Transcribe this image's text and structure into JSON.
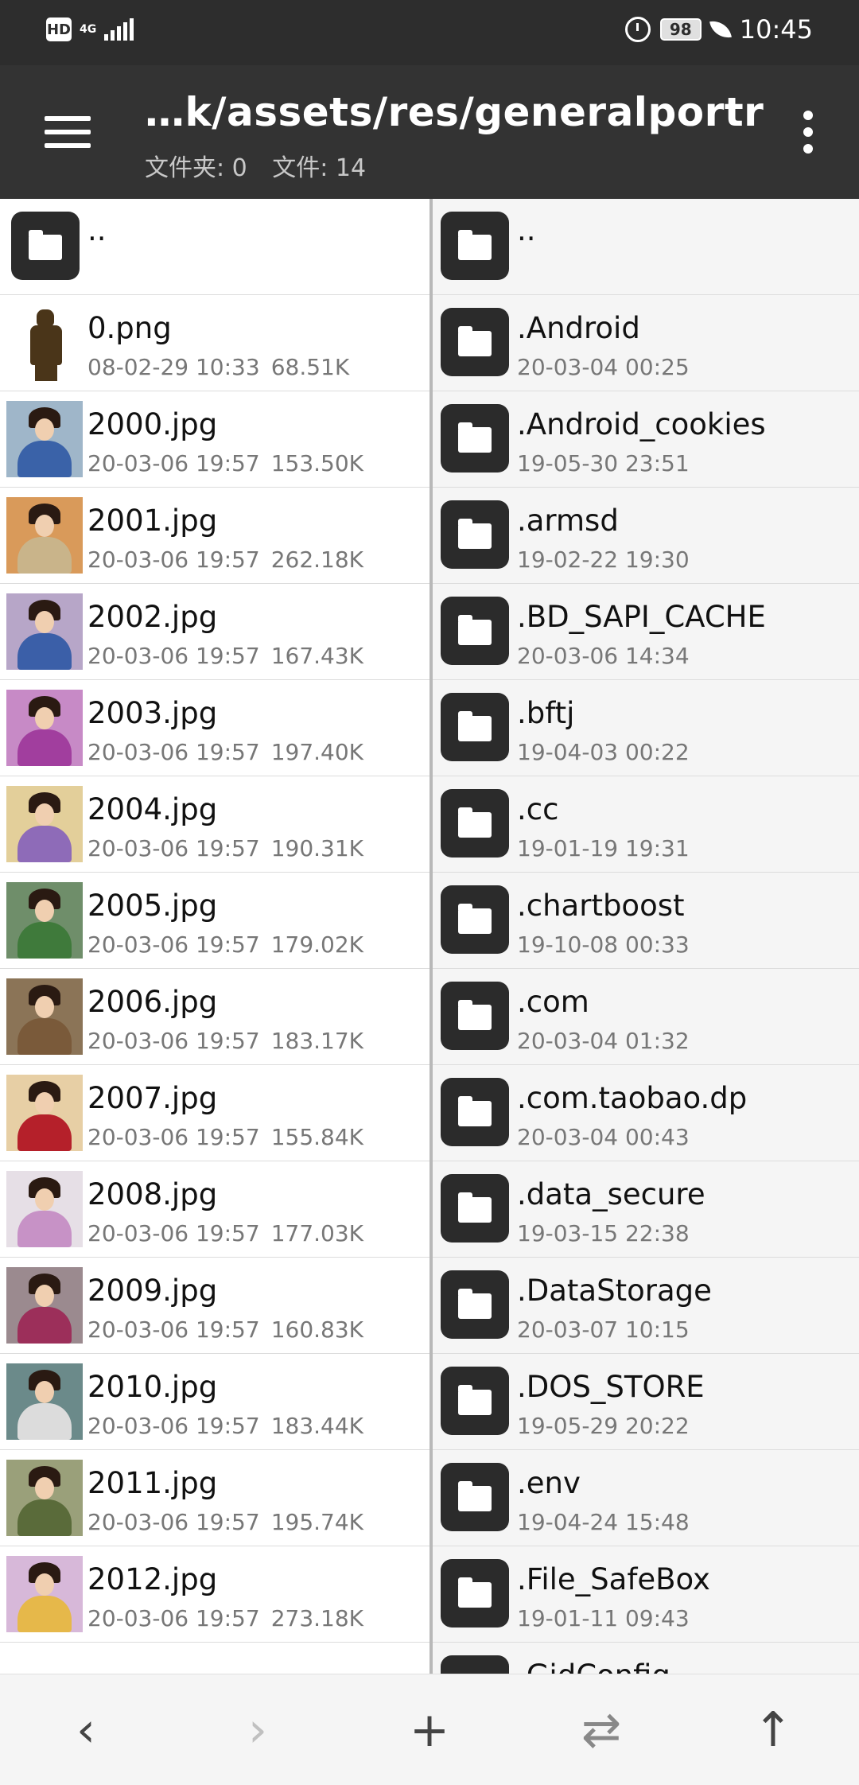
{
  "status_bar": {
    "hd_label": "HD",
    "network_label": "4G",
    "battery": "98",
    "time": "10:45"
  },
  "toolbar": {
    "path": "…k/assets/res/generalportrait/",
    "folder_count_label": "文件夹: 0",
    "file_count_label": "文件: 14"
  },
  "left_pane": {
    "parent_label": "..",
    "files": [
      {
        "name": "0.png",
        "date": "08-02-29 10:33",
        "size": "68.51K",
        "thumb": "silhouette"
      },
      {
        "name": "2000.jpg",
        "date": "20-03-06 19:57",
        "size": "153.50K",
        "robe": "#3a62a8",
        "bg": "#9fb6c9"
      },
      {
        "name": "2001.jpg",
        "date": "20-03-06 19:57",
        "size": "262.18K",
        "robe": "#c9b48a",
        "bg": "#d99a5a"
      },
      {
        "name": "2002.jpg",
        "date": "20-03-06 19:57",
        "size": "167.43K",
        "robe": "#3b5fa8",
        "bg": "#b7a6c8"
      },
      {
        "name": "2003.jpg",
        "date": "20-03-06 19:57",
        "size": "197.40K",
        "robe": "#a13e9e",
        "bg": "#c78ac6"
      },
      {
        "name": "2004.jpg",
        "date": "20-03-06 19:57",
        "size": "190.31K",
        "robe": "#8e6bb8",
        "bg": "#e3cf9a"
      },
      {
        "name": "2005.jpg",
        "date": "20-03-06 19:57",
        "size": "179.02K",
        "robe": "#3f7a3b",
        "bg": "#6f8e6a"
      },
      {
        "name": "2006.jpg",
        "date": "20-03-06 19:57",
        "size": "183.17K",
        "robe": "#7a5a3a",
        "bg": "#8b7457"
      },
      {
        "name": "2007.jpg",
        "date": "20-03-06 19:57",
        "size": "155.84K",
        "robe": "#b5202a",
        "bg": "#e7cfa5"
      },
      {
        "name": "2008.jpg",
        "date": "20-03-06 19:57",
        "size": "177.03K",
        "robe": "#c792c6",
        "bg": "#e6dfe6"
      },
      {
        "name": "2009.jpg",
        "date": "20-03-06 19:57",
        "size": "160.83K",
        "robe": "#9c2f5a",
        "bg": "#9b8a8f"
      },
      {
        "name": "2010.jpg",
        "date": "20-03-06 19:57",
        "size": "183.44K",
        "robe": "#dcdcdc",
        "bg": "#6b8a8a"
      },
      {
        "name": "2011.jpg",
        "date": "20-03-06 19:57",
        "size": "195.74K",
        "robe": "#5a6b3a",
        "bg": "#9aa07a"
      },
      {
        "name": "2012.jpg",
        "date": "20-03-06 19:57",
        "size": "273.18K",
        "robe": "#e6b84a",
        "bg": "#d7b8d9"
      }
    ]
  },
  "right_pane": {
    "parent_label": "..",
    "folders": [
      {
        "name": ".Android",
        "date": "20-03-04 00:25"
      },
      {
        "name": ".Android_cookies",
        "date": "19-05-30 23:51"
      },
      {
        "name": ".armsd",
        "date": "19-02-22 19:30"
      },
      {
        "name": ".BD_SAPI_CACHE",
        "date": "20-03-06 14:34"
      },
      {
        "name": ".bftj",
        "date": "19-04-03 00:22"
      },
      {
        "name": ".cc",
        "date": "19-01-19 19:31"
      },
      {
        "name": ".chartboost",
        "date": "19-10-08 00:33"
      },
      {
        "name": ".com",
        "date": "20-03-04 01:32"
      },
      {
        "name": ".com.taobao.dp",
        "date": "20-03-04 00:43"
      },
      {
        "name": ".data_secure",
        "date": "19-03-15 22:38"
      },
      {
        "name": ".DataStorage",
        "date": "20-03-07 10:15"
      },
      {
        "name": ".DOS_STORE",
        "date": "19-05-29 20:22"
      },
      {
        "name": ".env",
        "date": "19-04-24 15:48"
      },
      {
        "name": ".File_SafeBox",
        "date": "19-01-11 09:43"
      },
      {
        "name": ".GidConfig",
        "date": ""
      }
    ]
  },
  "bottom_bar": {
    "back_icon": "chevron-left-icon",
    "forward_icon": "chevron-right-icon",
    "add_icon": "plus-icon",
    "swap_icon": "swap-icon",
    "up_icon": "arrow-up-icon",
    "back_glyph": "‹",
    "forward_glyph": "›",
    "add_glyph": "+",
    "swap_glyph": "⇄",
    "up_glyph": "↑"
  }
}
